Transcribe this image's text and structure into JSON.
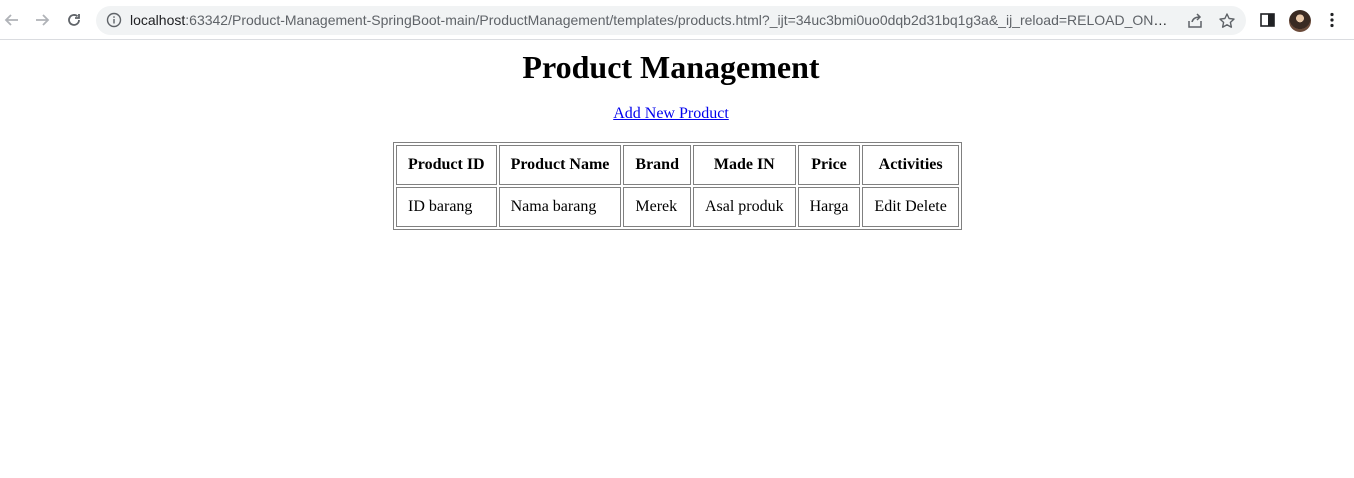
{
  "browser": {
    "url_host": "localhost",
    "url_rest": ":63342/Product-Management-SpringBoot-main/ProductManagement/templates/products.html?_ijt=34uc3bmi0uo0dqb2d31bq1g3a&_ij_reload=RELOAD_ON_..."
  },
  "page": {
    "title": "Product Management",
    "add_link": "Add New Product"
  },
  "table": {
    "headers": [
      "Product ID",
      "Product Name",
      "Brand",
      "Made IN",
      "Price",
      "Activities"
    ],
    "rows": [
      {
        "id": "ID barang",
        "name": "Nama barang",
        "brand": "Merek",
        "made_in": "Asal produk",
        "price": "Harga",
        "edit": "Edit",
        "delete": "Delete"
      }
    ]
  }
}
